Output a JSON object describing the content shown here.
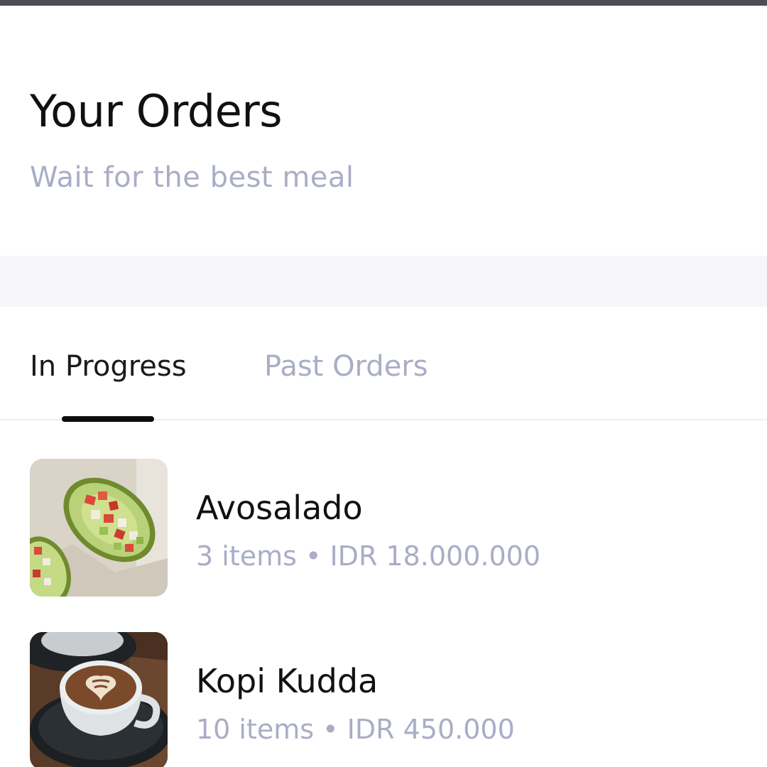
{
  "header": {
    "title": "Your Orders",
    "subtitle": "Wait for the best meal"
  },
  "tabs": [
    {
      "label": "In Progress",
      "active": true
    },
    {
      "label": "Past Orders",
      "active": false
    }
  ],
  "orders": [
    {
      "name": "Avosalado",
      "meta": "3 items • IDR 18.000.000",
      "image": "avocado-salad-photo"
    },
    {
      "name": "Kopi Kudda",
      "meta": "10 items • IDR 450.000",
      "image": "latte-coffee-photo"
    }
  ],
  "colors": {
    "text_primary": "#111111",
    "text_muted": "#a9adc6",
    "band": "#f6f6fa",
    "top_strip": "#4a4d52"
  }
}
